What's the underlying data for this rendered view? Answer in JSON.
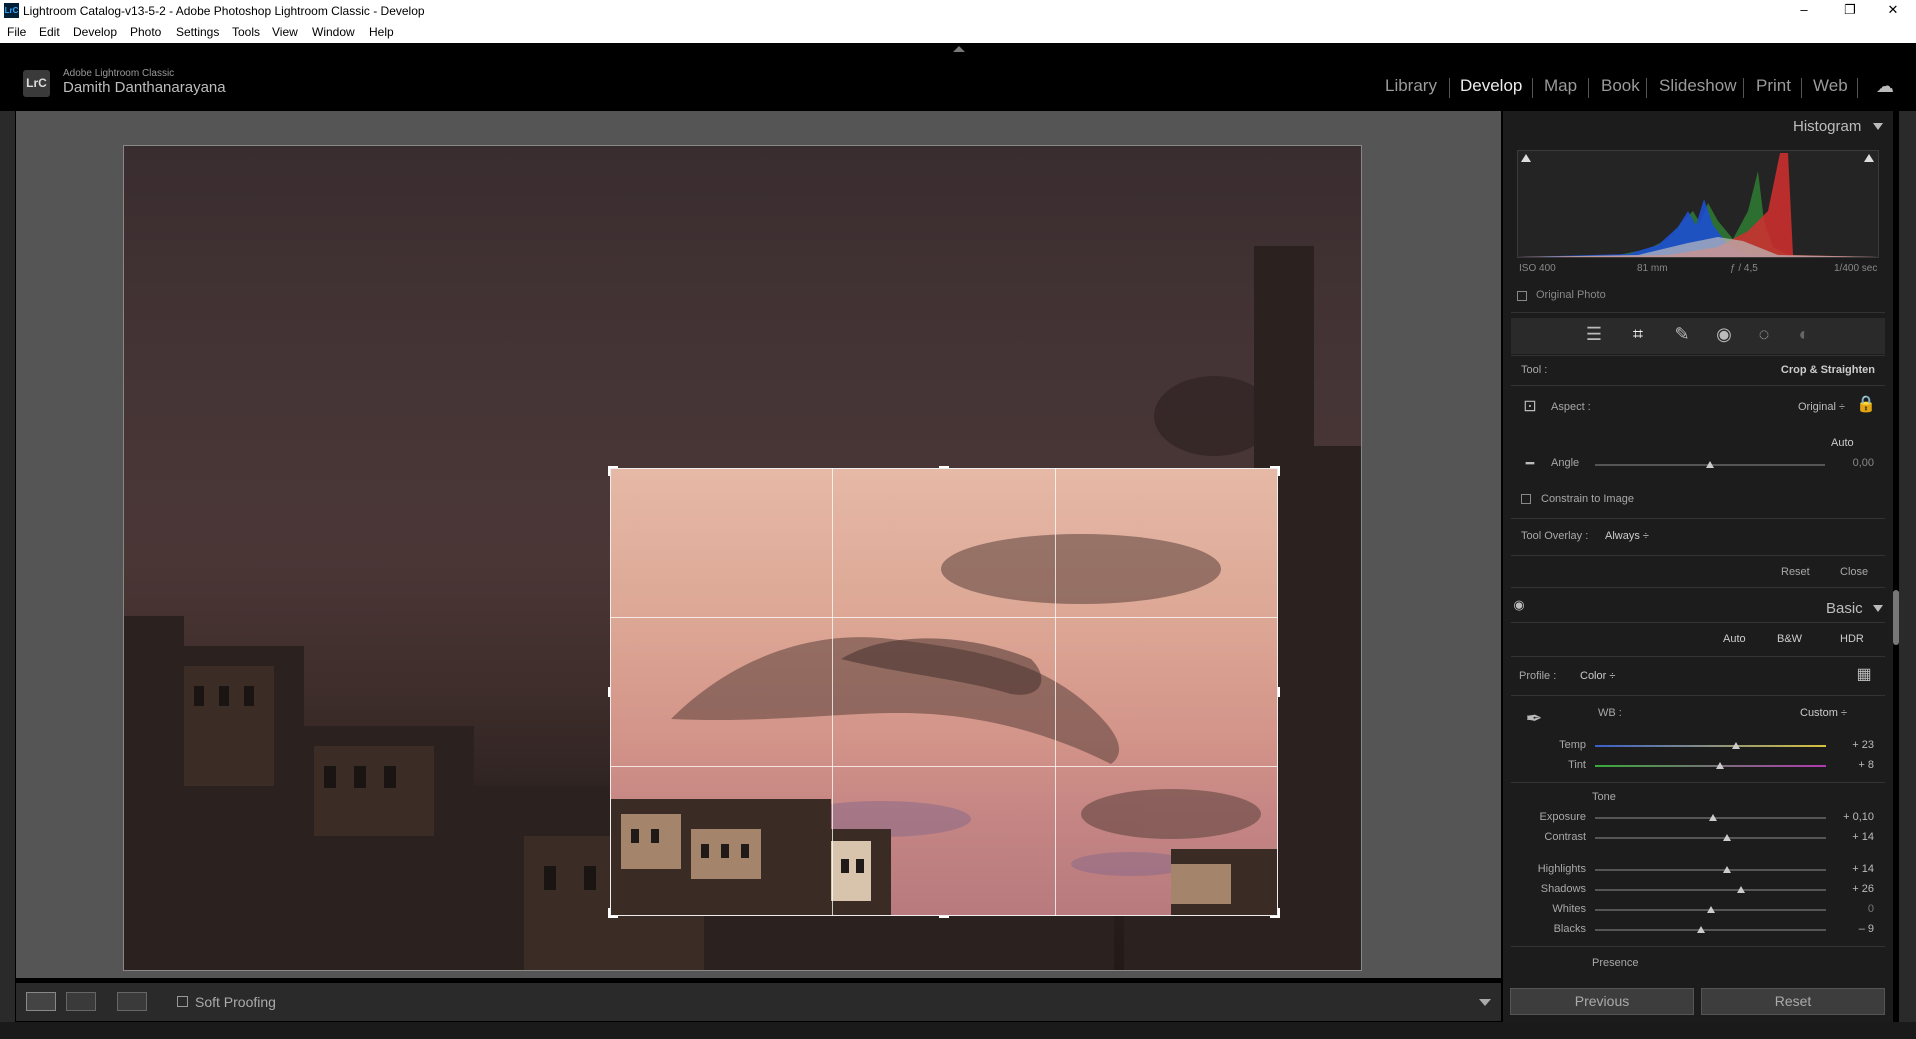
{
  "window": {
    "title": "Lightroom Catalog-v13-5-2 - Adobe Photoshop Lightroom Classic - Develop",
    "app_icon": "LrC",
    "controls": [
      "–",
      "❐",
      "✕"
    ]
  },
  "menu": [
    "File",
    "Edit",
    "Develop",
    "Photo",
    "Settings",
    "Tools",
    "View",
    "Window",
    "Help"
  ],
  "identity": {
    "logo": "LrC",
    "product": "Adobe Lightroom Classic",
    "user": "Damith Danthanarayana"
  },
  "modules": {
    "items": [
      "Library",
      "Develop",
      "Map",
      "Book",
      "Slideshow",
      "Print",
      "Web"
    ],
    "active": "Develop",
    "cloud_icon": "cloud-sync-icon"
  },
  "toolbar": {
    "soft_proofing": "Soft Proofing",
    "view_modes": [
      "loupe-view-icon",
      "before-after-icon",
      "yy-compare-icon"
    ]
  },
  "histogram": {
    "title": "Histogram",
    "iso": "ISO 400",
    "focal": "81 mm",
    "aperture": "ƒ / 4,5",
    "shutter": "1/400 sec",
    "original_photo": "Original Photo"
  },
  "crop": {
    "tool_label": "Tool :",
    "tool_value": "Crop & Straighten",
    "aspect_label": "Aspect :",
    "aspect_value": "Original ÷",
    "auto_label": "Auto",
    "angle_label": "Angle",
    "angle_value": "0,00",
    "angle_pos": 0.5,
    "constrain_label": "Constrain to Image",
    "overlay_label": "Tool Overlay :",
    "overlay_value": "Always ÷",
    "reset": "Reset",
    "close": "Close"
  },
  "basic": {
    "title": "Basic",
    "auto": "Auto",
    "bw": "B&W",
    "hdr": "HDR",
    "profile_label": "Profile :",
    "profile_value": "Color ÷",
    "wb_label": "WB :",
    "wb_value": "Custom ÷",
    "tone_label": "Tone",
    "presence_label": "Presence",
    "sliders": [
      {
        "name": "Temp",
        "value": "+ 23",
        "pos": 0.61
      },
      {
        "name": "Tint",
        "value": "+ 8",
        "pos": 0.54
      },
      {
        "name": "Exposure",
        "value": "+ 0,10",
        "pos": 0.51
      },
      {
        "name": "Contrast",
        "value": "+ 14",
        "pos": 0.57
      },
      {
        "name": "Highlights",
        "value": "+ 14",
        "pos": 0.57
      },
      {
        "name": "Shadows",
        "value": "+ 26",
        "pos": 0.63
      },
      {
        "name": "Whites",
        "value": "0",
        "pos": 0.5
      },
      {
        "name": "Blacks",
        "value": "– 9",
        "pos": 0.46
      }
    ]
  },
  "footer": {
    "previous": "Previous",
    "reset": "Reset"
  },
  "colors": {
    "panel_bg": "#1c1c1c",
    "work_bg": "#555555",
    "accent_temp_start": "#3b5fc8",
    "accent_temp_end": "#d6c23c",
    "accent_tint_start": "#3aaa3a",
    "accent_tint_end": "#b03ab0"
  }
}
